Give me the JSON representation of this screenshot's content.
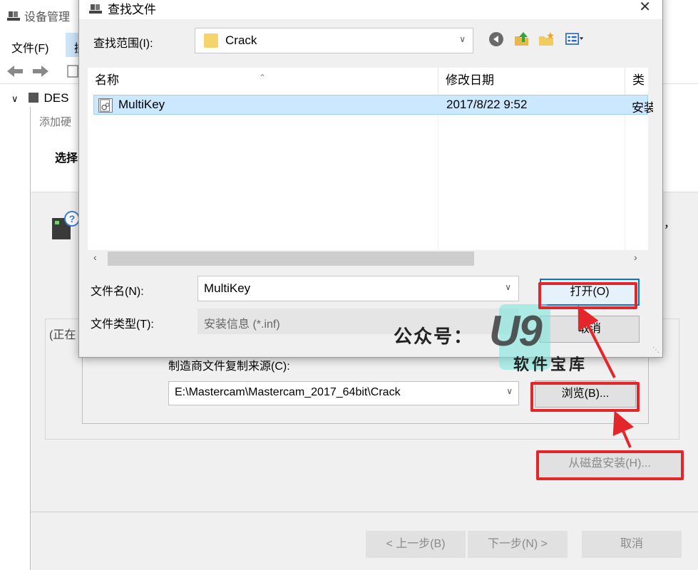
{
  "device_manager": {
    "title": "设备管理",
    "menu_file": "文件(F)",
    "menu_action": "操",
    "tree_node": "DES"
  },
  "wizard": {
    "title": "添加硬",
    "heading": "选择",
    "side_text": "，",
    "group_label": "(正在",
    "have_disk": "从磁盘安装(H)...",
    "back": "< 上一步(B)",
    "next": "下一步(N) >",
    "cancel": "取消"
  },
  "install_from_disk": {
    "label": "制造商文件复制来源(C):",
    "path": "E:\\Mastercam\\Mastercam_2017_64bit\\Crack",
    "browse": "浏览(B)..."
  },
  "find_file": {
    "title": "查找文件",
    "look_in_label": "查找范围(I):",
    "look_in_value": "Crack",
    "columns": {
      "name": "名称",
      "date": "修改日期",
      "type": "类型"
    },
    "files": [
      {
        "name": "MultiKey",
        "date": "2017/8/22 9:52",
        "type": "安装"
      }
    ],
    "filename_label": "文件名(N):",
    "filename_value": "MultiKey",
    "filetype_label": "文件类型(T):",
    "filetype_value": "安装信息 (*.inf)",
    "open": "打开(O)",
    "cancel": "取消"
  },
  "watermark": {
    "prefix": "公众号：",
    "brand": "U9",
    "subtitle": "软件宝库"
  },
  "colors": {
    "highlight": "#e3262a",
    "selection": "#cce8ff",
    "default_button_border": "#0078d7"
  }
}
